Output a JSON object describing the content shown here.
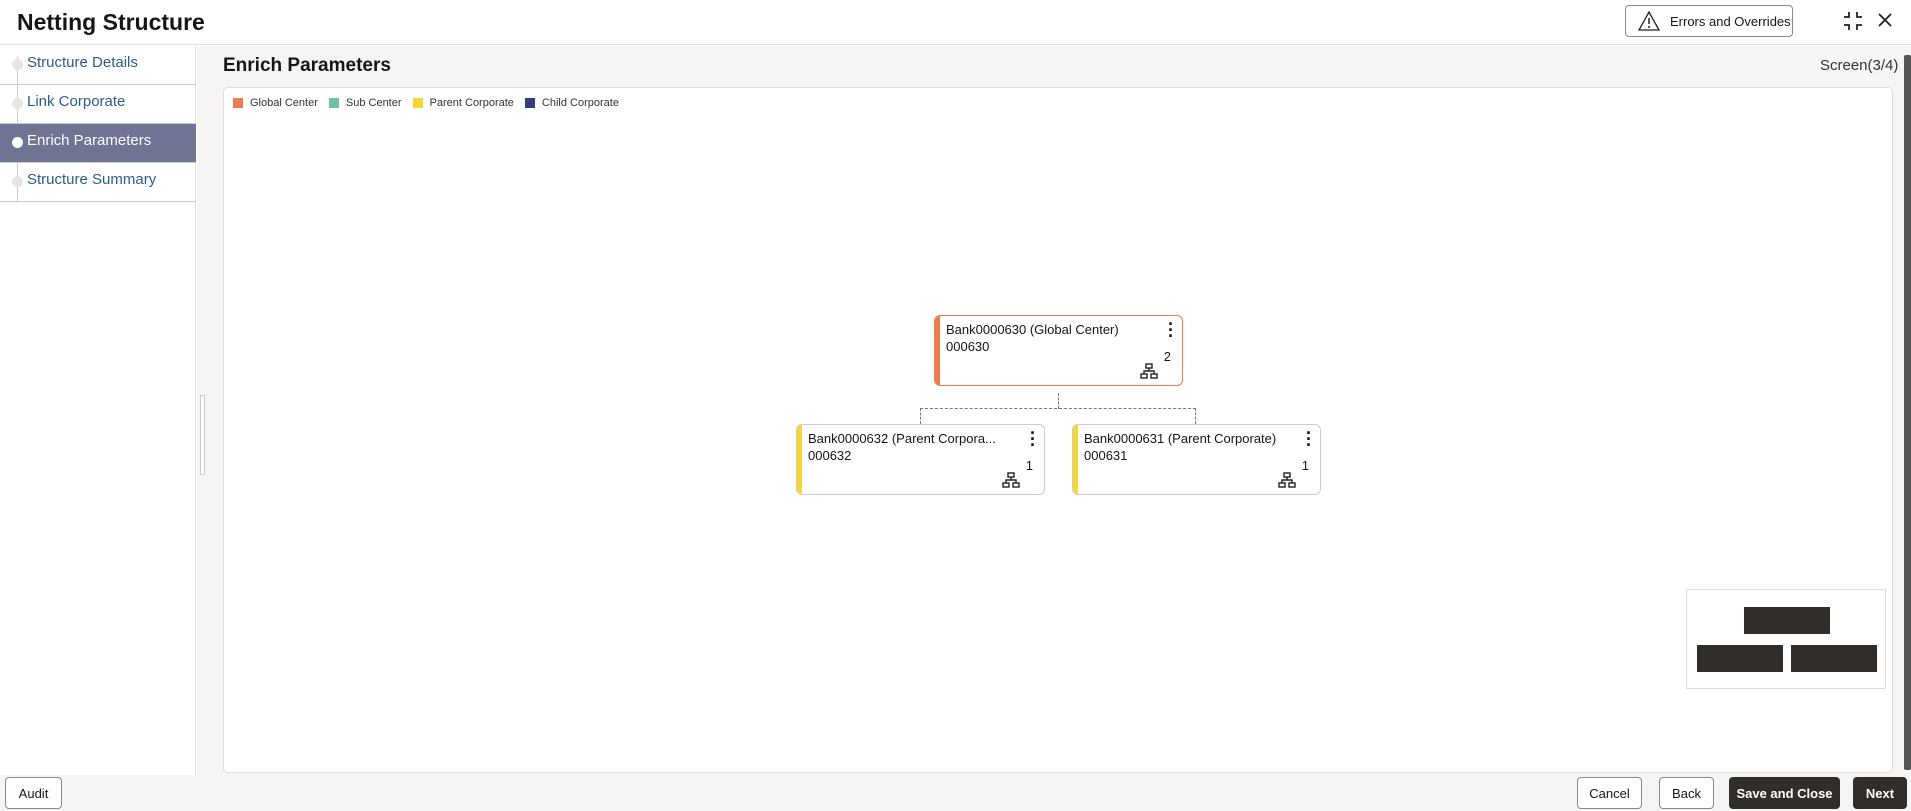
{
  "header": {
    "title": "Netting Structure",
    "errors_button": "Errors and Overrides"
  },
  "sidebar": {
    "steps": [
      {
        "label": "Structure Details"
      },
      {
        "label": "Link Corporate"
      },
      {
        "label": "Enrich Parameters",
        "active": true
      },
      {
        "label": "Structure Summary"
      }
    ]
  },
  "main": {
    "title": "Enrich Parameters",
    "screen_indicator": "Screen(3/4)"
  },
  "legend": [
    {
      "label": "Global Center",
      "color": "#ed7d4e"
    },
    {
      "label": "Sub Center",
      "color": "#6cc3a4"
    },
    {
      "label": "Parent Corporate",
      "color": "#f7d631"
    },
    {
      "label": "Child Corporate",
      "color": "#343c82"
    }
  ],
  "nodes": [
    {
      "name": "Bank0000630 (Global Center)",
      "code": "000630",
      "children": "2",
      "color": "#ed7d4e"
    },
    {
      "name": "Bank0000632 (Parent Corpora...",
      "code": "000632",
      "children": "1",
      "color": "#f7d631"
    },
    {
      "name": "Bank0000631 (Parent Corporate)",
      "code": "000631",
      "children": "1",
      "color": "#f7d631"
    }
  ],
  "footer": {
    "audit": "Audit",
    "cancel": "Cancel",
    "back": "Back",
    "save_close": "Save and Close",
    "next": "Next"
  }
}
